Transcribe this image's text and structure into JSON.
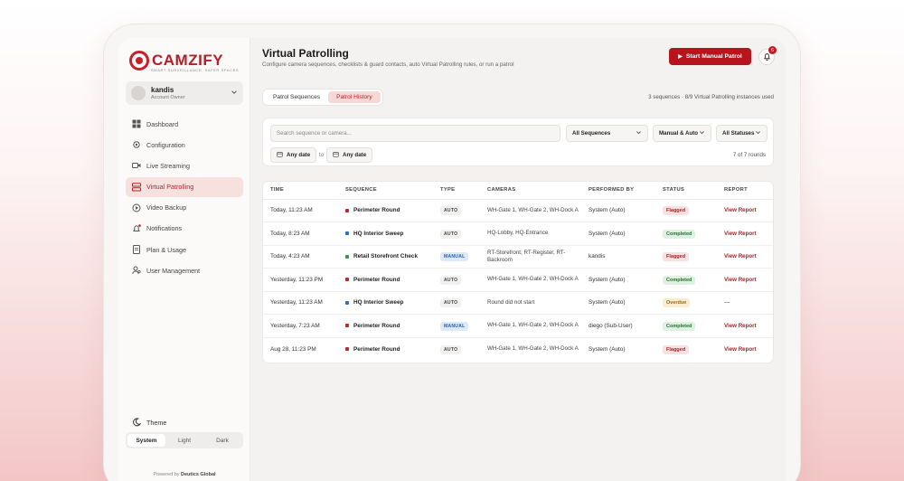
{
  "brand": {
    "name": "CAMZIFY",
    "tagline": "SMART SURVEILLANCE, SAFER SPACES",
    "accent": "#b8141d"
  },
  "user": {
    "name": "kandis",
    "role": "Account Owner"
  },
  "nav": [
    {
      "label": "Dashboard",
      "icon": "grid-icon"
    },
    {
      "label": "Configuration",
      "icon": "gear-icon"
    },
    {
      "label": "Live Streaming",
      "icon": "camera-icon"
    },
    {
      "label": "Virtual Patrolling",
      "icon": "list-icon",
      "active": true
    },
    {
      "label": "Video Backup",
      "icon": "backup-icon"
    },
    {
      "label": "Notifications",
      "icon": "bell-icon"
    },
    {
      "label": "Plan & Usage",
      "icon": "document-icon"
    },
    {
      "label": "User Management",
      "icon": "users-icon"
    }
  ],
  "theme": {
    "label": "Theme",
    "options": [
      "System",
      "Light",
      "Dark"
    ],
    "selected": "System"
  },
  "powered": {
    "prefix": "Powered by",
    "name": "Deutics Global"
  },
  "header": {
    "title": "Virtual Patrolling",
    "subtitle": "Configure camera sequences, checklists & guard contacts, auto Virtual Patrolling rules, or run a patrol",
    "primary_button": "Start Manual Patrol",
    "notification_count": "6"
  },
  "tabs": [
    {
      "label": "Patrol Sequences",
      "active": false
    },
    {
      "label": "Patrol History",
      "active": true
    }
  ],
  "summary": "3 sequences · 8/9 Virtual Patrolling instances used",
  "filters": {
    "search_placeholder": "Search sequence or camera...",
    "sequence_select": "All Sequences",
    "type_select": "Manual & Auto",
    "status_select": "All Statuses",
    "date_from": "Any date",
    "to_label": "to",
    "date_to": "Any date",
    "rounds": "7 of 7 rounds"
  },
  "table": {
    "headers": [
      "TIME",
      "SEQUENCE",
      "TYPE",
      "CAMERAS",
      "PERFORMED BY",
      "STATUS",
      "REPORT"
    ],
    "rows": [
      {
        "time": "Today, 11:23 AM",
        "sequence": "Perimeter Round",
        "dot": "#c0272d",
        "type": "AUTO",
        "cameras": "WH-Gate 1, WH-Gate 2, WH-Dock A",
        "by": "System (Auto)",
        "status": "Flagged",
        "report": "View Report"
      },
      {
        "time": "Today, 8:23 AM",
        "sequence": "HQ Interior Sweep",
        "dot": "#2a6fc4",
        "type": "AUTO",
        "cameras": "HQ-Lobby, HQ-Entrance",
        "by": "System (Auto)",
        "status": "Completed",
        "report": "View Report"
      },
      {
        "time": "Today, 4:23 AM",
        "sequence": "Retail Storefront Check",
        "dot": "#2f9a4a",
        "type": "MANUAL",
        "cameras": "RT-Storefront, RT-Register, RT-Backroom",
        "by": "kandis",
        "status": "Flagged",
        "report": "View Report"
      },
      {
        "time": "Yesterday, 11:23 PM",
        "sequence": "Perimeter Round",
        "dot": "#c0272d",
        "type": "AUTO",
        "cameras": "WH-Gate 1, WH-Gate 2, WH-Dock A",
        "by": "System (Auto)",
        "status": "Completed",
        "report": "View Report"
      },
      {
        "time": "Yesterday, 11:23 AM",
        "sequence": "HQ Interior Sweep",
        "dot": "#2a6fc4",
        "type": "AUTO",
        "cameras": "Round did not start",
        "by": "System (Auto)",
        "status": "Overdue",
        "report": "—"
      },
      {
        "time": "Yesterday, 7:23 AM",
        "sequence": "Perimeter Round",
        "dot": "#c0272d",
        "type": "MANUAL",
        "cameras": "WH-Gate 1, WH-Gate 2, WH-Dock A",
        "by": "diego (Sub-User)",
        "status": "Completed",
        "report": "View Report"
      },
      {
        "time": "Aug 28, 11:23 PM",
        "sequence": "Perimeter Round",
        "dot": "#c0272d",
        "type": "AUTO",
        "cameras": "WH-Gate 1, WH-Gate 2, WH-Dock A",
        "by": "System (Auto)",
        "status": "Flagged",
        "report": "View Report"
      }
    ]
  }
}
